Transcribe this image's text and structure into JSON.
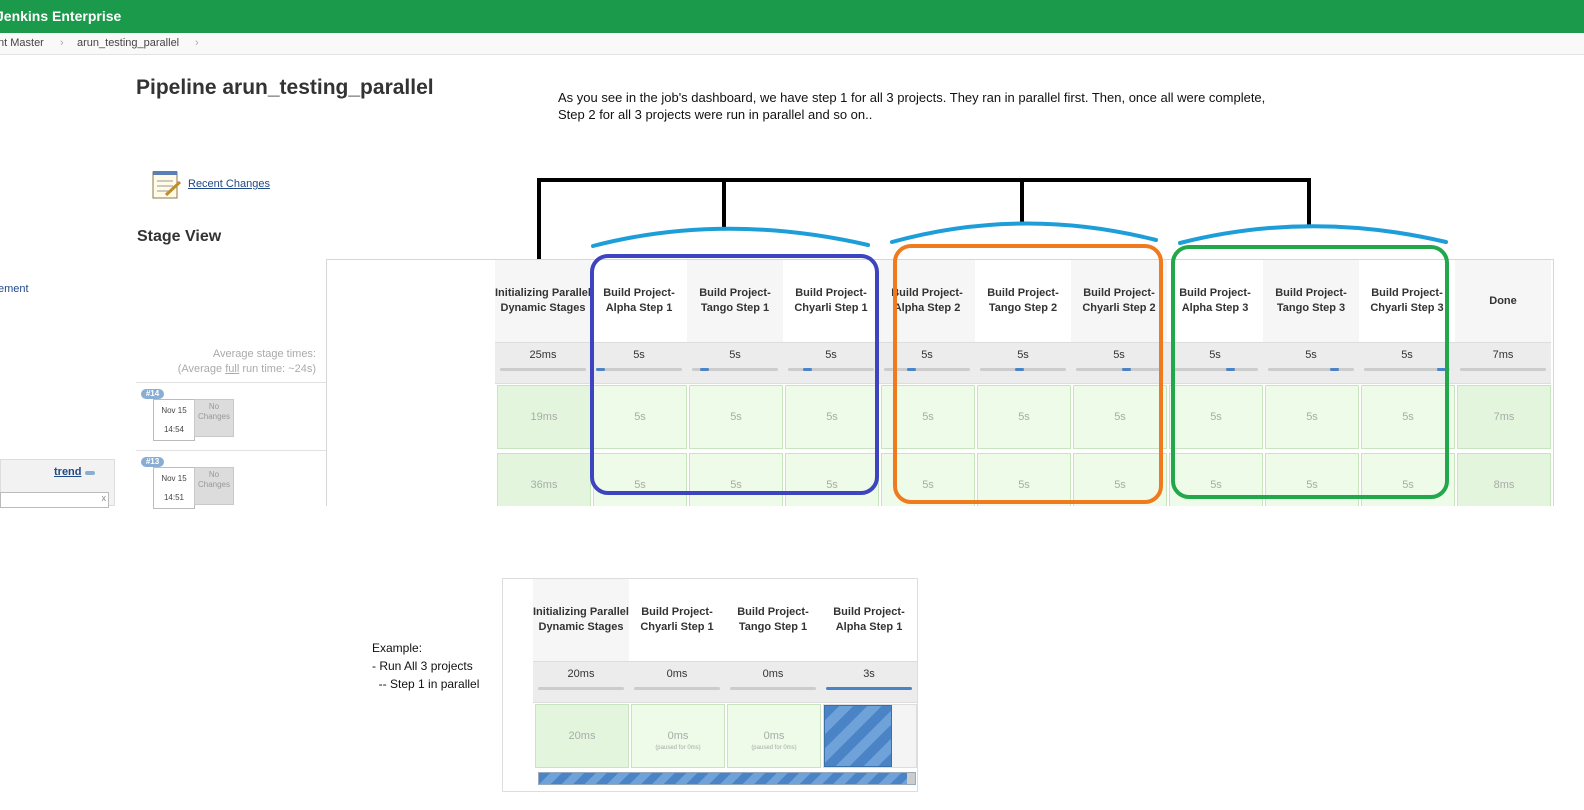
{
  "header": {
    "brand": "Jenkins Enterprise"
  },
  "breadcrumb": [
    "nt Master",
    "arun_testing_parallel"
  ],
  "page": {
    "title": "Pipeline arun_testing_parallel",
    "note_line1": "As you see in the job's dashboard, we have step 1 for all 3 projects. They ran in parallel first. Then, once all were complete,",
    "note_line2": "Step 2 for all 3 projects were run in parallel and so on.."
  },
  "sidebar": {
    "recent_changes": "Recent Changes",
    "fragment": "ement",
    "trend": "trend",
    "search_clear": "x"
  },
  "stage_view": {
    "title": "Stage View",
    "avg_line1": "Average stage times:",
    "avg_pre": "(Average ",
    "avg_full": "full",
    "avg_post": " run time: ~24s)",
    "stages": [
      {
        "name": "Initializing Parallel Dynamic Stages",
        "avg": "25ms",
        "bar": 0,
        "runs": [
          "19ms",
          "36ms"
        ]
      },
      {
        "name": "Build Project-Alpha Step 1",
        "avg": "5s",
        "bar": 0.0,
        "runs": [
          "5s",
          "5s"
        ]
      },
      {
        "name": "Build Project-Tango Step 1",
        "avg": "5s",
        "bar": 0.1,
        "runs": [
          "5s",
          "5s"
        ]
      },
      {
        "name": "Build Project-Chyarli Step 1",
        "avg": "5s",
        "bar": 0.2,
        "runs": [
          "5s",
          "5s"
        ]
      },
      {
        "name": "Build Project-Alpha Step 2",
        "avg": "5s",
        "bar": 0.3,
        "runs": [
          "5s",
          "5s"
        ]
      },
      {
        "name": "Build Project-Tango Step 2",
        "avg": "5s",
        "bar": 0.45,
        "runs": [
          "5s",
          "5s"
        ]
      },
      {
        "name": "Build Project-Chyarli Step 2",
        "avg": "5s",
        "bar": 0.6,
        "runs": [
          "5s",
          "5s"
        ]
      },
      {
        "name": "Build Project-Alpha Step 3",
        "avg": "5s",
        "bar": 0.7,
        "runs": [
          "5s",
          "5s"
        ]
      },
      {
        "name": "Build Project-Tango Step 3",
        "avg": "5s",
        "bar": 0.8,
        "runs": [
          "5s",
          "5s"
        ]
      },
      {
        "name": "Build Project-Chyarli Step 3",
        "avg": "5s",
        "bar": 0.95,
        "runs": [
          "5s",
          "5s"
        ]
      },
      {
        "name": "Done",
        "avg": "7ms",
        "bar": 0,
        "runs": [
          "7ms",
          "8ms"
        ]
      }
    ],
    "runs": [
      {
        "id": "#14",
        "date": "Nov 15",
        "time": "14:54",
        "changes": "No Changes"
      },
      {
        "id": "#13",
        "date": "Nov 15",
        "time": "14:51",
        "changes": "No Changes"
      }
    ]
  },
  "example": {
    "label_line1": "Example:",
    "label_line2": "- Run All 3 projects",
    "label_line3": "  -- Step 1 in parallel",
    "paused_text": "(paused for 0ms)",
    "stages": [
      {
        "name": "Initializing Parallel Dynamic Stages",
        "avg": "20ms",
        "run": "20ms"
      },
      {
        "name": "Build Project-Chyarli Step 1",
        "avg": "0ms",
        "run": "0ms"
      },
      {
        "name": "Build Project-Tango Step 1",
        "avg": "0ms",
        "run": "0ms"
      },
      {
        "name": "Build Project-Alpha Step 1",
        "avg": "3s",
        "run": ""
      }
    ]
  },
  "colors": {
    "header_green": "#1a9a4a",
    "group1": "#3d44c0",
    "group2": "#f07b1e",
    "group3": "#22a84a",
    "brace": "#1e9ed8",
    "connector": "#000000"
  }
}
